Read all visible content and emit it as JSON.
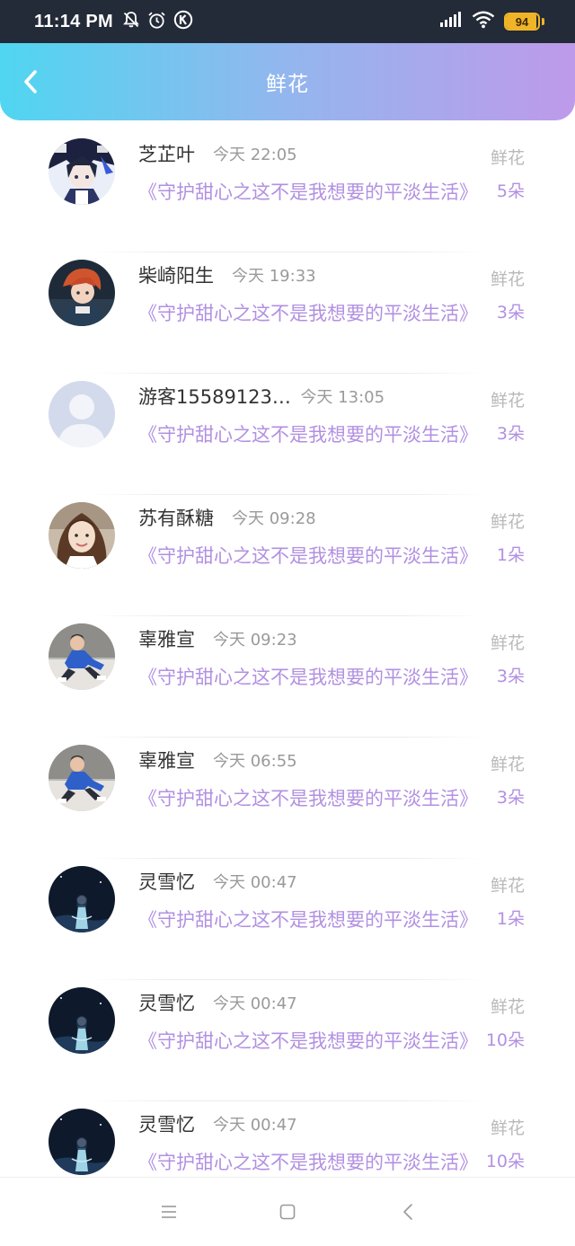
{
  "status_bar": {
    "time": "11:14 PM",
    "left_icons": [
      "mute-bell-icon",
      "alarm-icon",
      "k-badge-icon"
    ],
    "battery_level": 94,
    "battery_text": "94",
    "colors": {
      "background": "#232a38",
      "battery": "#f0b429"
    }
  },
  "header": {
    "title": "鲜花",
    "back_icon": "chevron-left-icon",
    "gradient": [
      "#4fd6f0",
      "#93b6ee",
      "#be9aea"
    ]
  },
  "list": {
    "items": [
      {
        "name": "芝芷叶",
        "time": "今天 22:05",
        "book": "《守护甜心之这不是我想要的平淡生活》",
        "type": "鲜花",
        "count": "5朵",
        "avatar": "anime-boy-avatar"
      },
      {
        "name": "柴崎阳生",
        "time": "今天 19:33",
        "book": "《守护甜心之这不是我想要的平淡生活》",
        "type": "鲜花",
        "count": "3朵",
        "avatar": "anime-redhair-avatar"
      },
      {
        "name": "游客15589123…",
        "time": "今天 13:05",
        "book": "《守护甜心之这不是我想要的平淡生活》",
        "type": "鲜花",
        "count": "3朵",
        "avatar": "default-user-avatar"
      },
      {
        "name": "苏有酥糖",
        "time": "今天 09:28",
        "book": "《守护甜心之这不是我想要的平淡生活》",
        "type": "鲜花",
        "count": "1朵",
        "avatar": "girl-photo-avatar"
      },
      {
        "name": "辜雅宣",
        "time": "今天 09:23",
        "book": "《守护甜心之这不是我想要的平淡生活》",
        "type": "鲜花",
        "count": "3朵",
        "avatar": "boy-photo-avatar"
      },
      {
        "name": "辜雅宣",
        "time": "今天 06:55",
        "book": "《守护甜心之这不是我想要的平淡生活》",
        "type": "鲜花",
        "count": "3朵",
        "avatar": "boy-photo-avatar"
      },
      {
        "name": "灵雪忆",
        "time": "今天 00:47",
        "book": "《守护甜心之这不是我想要的平淡生活》",
        "type": "鲜花",
        "count": "1朵",
        "avatar": "night-fairy-avatar"
      },
      {
        "name": "灵雪忆",
        "time": "今天 00:47",
        "book": "《守护甜心之这不是我想要的平淡生活》",
        "type": "鲜花",
        "count": "10朵",
        "avatar": "night-fairy-avatar"
      },
      {
        "name": "灵雪忆",
        "time": "今天 00:47",
        "book": "《守护甜心之这不是我想要的平淡生活》",
        "type": "鲜花",
        "count": "10朵",
        "avatar": "night-fairy-avatar"
      }
    ]
  },
  "nav_bar": {
    "buttons": [
      "menu-icon",
      "home-square-icon",
      "back-triangle-icon"
    ]
  }
}
